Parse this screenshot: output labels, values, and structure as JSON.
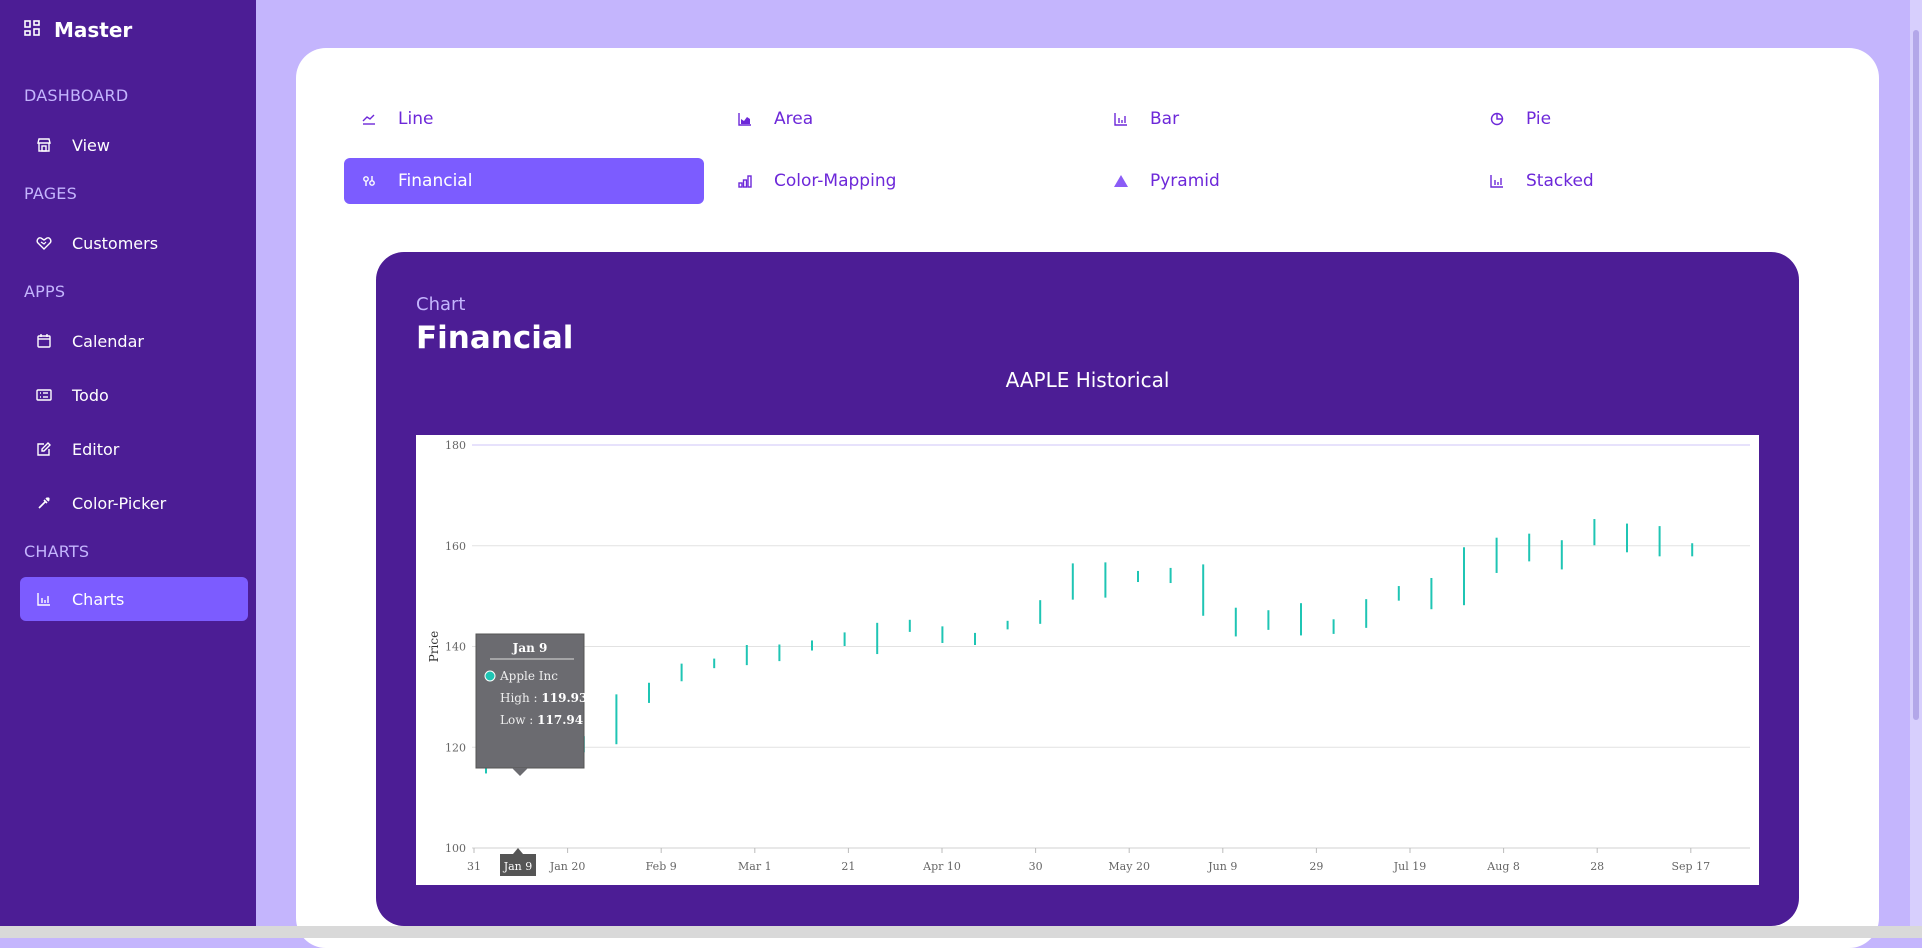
{
  "sidebar": {
    "brand": "Master",
    "sections": [
      {
        "title": "DASHBOARD",
        "items": [
          {
            "label": "View",
            "icon": "shop-icon"
          }
        ]
      },
      {
        "title": "PAGES",
        "items": [
          {
            "label": "Customers",
            "icon": "handshake-icon"
          }
        ]
      },
      {
        "title": "APPS",
        "items": [
          {
            "label": "Calendar",
            "icon": "calendar-icon"
          },
          {
            "label": "Todo",
            "icon": "todo-icon"
          },
          {
            "label": "Editor",
            "icon": "edit-icon"
          },
          {
            "label": "Color-Picker",
            "icon": "eyedropper-icon"
          }
        ]
      },
      {
        "title": "CHARTS",
        "items": [
          {
            "label": "Charts",
            "icon": "bar-chart-icon",
            "active": true
          }
        ]
      }
    ]
  },
  "tabs": [
    {
      "label": "Line",
      "icon": "line-chart-icon"
    },
    {
      "label": "Area",
      "icon": "area-chart-icon"
    },
    {
      "label": "Bar",
      "icon": "bar-chart-icon"
    },
    {
      "label": "Pie",
      "icon": "pie-chart-icon"
    },
    {
      "label": "Financial",
      "icon": "financial-icon",
      "active": true
    },
    {
      "label": "Color-Mapping",
      "icon": "color-mapping-icon"
    },
    {
      "label": "Pyramid",
      "icon": "pyramid-icon"
    },
    {
      "label": "Stacked",
      "icon": "stacked-icon"
    }
  ],
  "chart": {
    "subtitle": "Chart",
    "title": "Financial",
    "caption": "AAPLE Historical"
  },
  "tooltip": {
    "date": "Jan 9",
    "series": "Apple Inc",
    "high_label": "High : ",
    "high_value": "119.93",
    "low_label": "Low : ",
    "low_value": "117.94",
    "crosshair_label": "Jan 9"
  },
  "colors": {
    "accent": "#7c5cff",
    "sidebar": "#4c1d95",
    "series": "#1fc5b4"
  },
  "chart_data": {
    "type": "hilo",
    "ylabel": "Price",
    "ylim": [
      100,
      180
    ],
    "yticks": [
      100,
      120,
      140,
      160,
      180
    ],
    "x_tick_labels": [
      "31",
      "Jan 20",
      "Feb 9",
      "Mar 1",
      "21",
      "Apr 10",
      "30",
      "May 20",
      "Jun 9",
      "29",
      "Jul 19",
      "Aug 8",
      "28",
      "Sep 17"
    ],
    "series": [
      {
        "name": "Apple Inc",
        "high": [
          118.0,
          119.93,
          120.6,
          122.2,
          130.5,
          132.8,
          136.6,
          137.6,
          140.3,
          140.4,
          141.2,
          142.8,
          144.7,
          145.3,
          144.0,
          142.7,
          145.1,
          149.2,
          156.5,
          156.7,
          155.0,
          155.6,
          156.3,
          147.7,
          147.2,
          148.6,
          145.4,
          149.4,
          152.0,
          153.6,
          159.7,
          161.6,
          162.4,
          161.1,
          165.3,
          164.4,
          163.9,
          160.5
        ],
        "low": [
          114.8,
          117.94,
          117.8,
          119.0,
          120.6,
          128.8,
          133.1,
          135.7,
          136.3,
          137.1,
          139.2,
          140.1,
          138.5,
          142.9,
          140.7,
          140.3,
          143.4,
          144.5,
          149.3,
          149.7,
          152.8,
          152.6,
          146.1,
          142.0,
          143.3,
          142.2,
          142.5,
          143.7,
          149.1,
          147.4,
          148.2,
          154.6,
          156.9,
          155.3,
          160.1,
          158.7,
          157.9,
          157.9
        ]
      }
    ]
  }
}
